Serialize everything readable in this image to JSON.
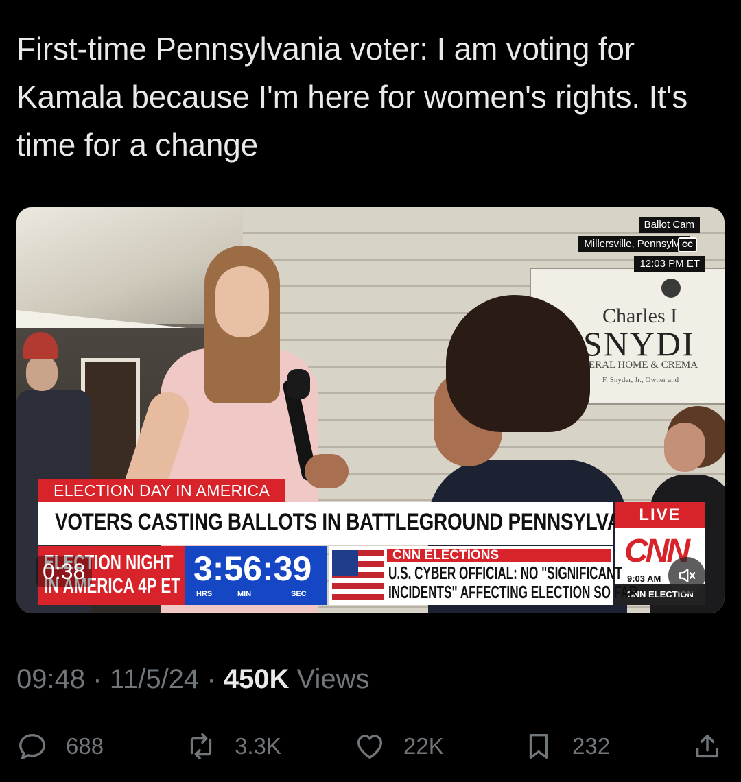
{
  "tweet": {
    "text": "First-time Pennsylvania voter: I am voting for Kamala because I'm here for women's rights. It's time for a change"
  },
  "video": {
    "ballot_cam_label": "Ballot Cam",
    "location": "Millersville, Pennsylva",
    "time": "12:03 PM ET",
    "cc_label": "CC",
    "sign": {
      "line1": "Charles I",
      "line2": "SNYDI",
      "line3": "ERAL HOME & CREMA",
      "line4": "F. Snyder, Jr., Owner and"
    },
    "chyron_tab": "ELECTION DAY IN AMERICA",
    "headline": "VOTERS CASTING BALLOTS IN BATTLEGROUND PENNSYLVANIA",
    "live_label": "LIVE",
    "network_logo": "CNN",
    "network_time": "9:03 AM",
    "network_strap": "CNN ELECTION",
    "promo": {
      "line1": "ELECTION NIGHT",
      "line2": "IN AMERICA 4P ET"
    },
    "countdown": {
      "value": "3:56:39",
      "hrs": "HRS",
      "min": "MIN",
      "sec": "SEC"
    },
    "ticker": {
      "header": "CNN ELECTIONS",
      "line1": "U.S. CYBER OFFICIAL: NO \"SIGNIFICANT",
      "line2": "INCIDENTS\" AFFECTING ELECTION SO FAR"
    },
    "elapsed": "0:38",
    "mute_icon": "speaker-muted-icon"
  },
  "meta": {
    "time": "09:48",
    "separator": "·",
    "date": "11/5/24",
    "views_count": "450K",
    "views_label": "Views"
  },
  "actions": {
    "replies": "688",
    "reposts": "3.3K",
    "likes": "22K",
    "bookmarks": "232"
  },
  "colors": {
    "background": "#000000",
    "text": "#e7e9ea",
    "secondary_text": "#71767b",
    "cnn_red": "#d8232a",
    "countdown_blue": "#1547c4"
  }
}
